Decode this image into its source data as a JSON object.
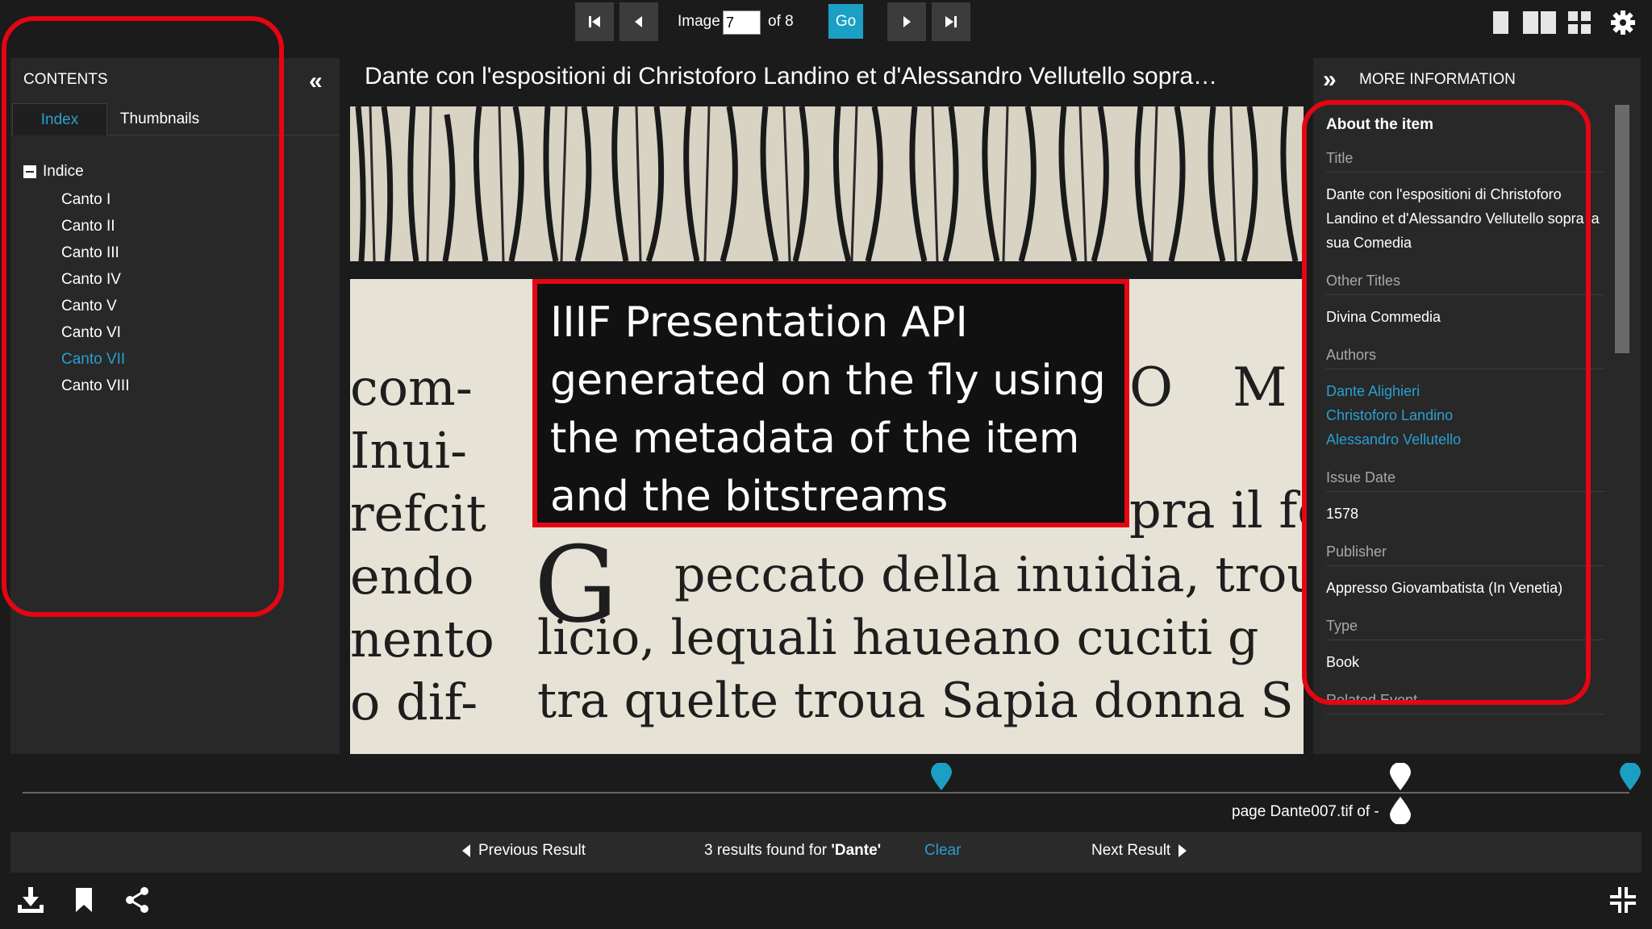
{
  "toolbar": {
    "image_label": "Image",
    "image_value": "7",
    "of_label": "of 8",
    "go_label": "Go",
    "icons": [
      "first-page-icon",
      "prev-page-icon",
      "next-page-icon",
      "last-page-icon",
      "one-up-icon",
      "two-up-icon",
      "gallery-icon",
      "settings-icon"
    ]
  },
  "contents": {
    "title": "CONTENTS",
    "collapse_glyph": "«",
    "tabs": [
      "Index",
      "Thumbnails"
    ],
    "tree_root": "Indice",
    "items": [
      "Canto I",
      "Canto II",
      "Canto III",
      "Canto IV",
      "Canto V",
      "Canto VI",
      "Canto VII",
      "Canto VIII"
    ],
    "active_item": "Canto VII"
  },
  "viewer": {
    "title": "Dante con l'espositioni di Christoforo Landino et d'Alessandro Vellutello sopra…",
    "book_lines": [
      "com-",
      "Inui-",
      "refcit",
      "endo",
      "nento",
      "o dif-",
      "O",
      "M",
      "pra il fe",
      "peccato della inuidia, trou",
      "licio, lequali haueano cuciti g",
      "tra quelte troua Sapia donna S"
    ],
    "drop_cap": "G"
  },
  "callout": {
    "text": "IIIF Presentation API generated on the fly using the metadata of the item and the bitstreams"
  },
  "more_info": {
    "title": "MORE INFORMATION",
    "expand_glyph": "»",
    "about": "About the item",
    "title_label": "Title",
    "title_value": "Dante con l'espositioni di Christoforo Landino et d'Alessandro Vellutello sopra la sua Comedia",
    "other_titles_label": "Other Titles",
    "other_titles_value": "Divina Commedia",
    "authors_label": "Authors",
    "authors": [
      "Dante Alighieri",
      "Christoforo Landino",
      "Alessandro Vellutello"
    ],
    "issue_date_label": "Issue Date",
    "issue_date_value": "1578",
    "publisher_label": "Publisher",
    "publisher_value": "Appresso Giovambatista (In Venetia)",
    "type_label": "Type",
    "type_value": "Book",
    "related_event_label": "Related Event"
  },
  "timeline": {
    "page_info": "page Dante007.tif of -"
  },
  "results": {
    "previous": "Previous Result",
    "count_text": "3 results found for ",
    "query": "'Dante'",
    "clear": "Clear",
    "next": "Next Result"
  },
  "colors": {
    "accent": "#1c9fc4",
    "link": "#2a9fd0",
    "highlight": "#e30613",
    "panel": "#282828",
    "background": "#1b1b1b"
  }
}
